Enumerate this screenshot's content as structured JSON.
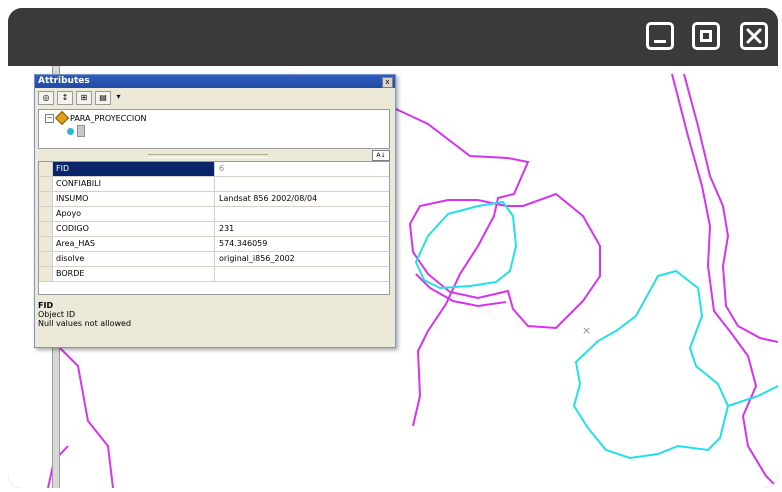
{
  "window": {
    "controls": [
      "minimize-icon",
      "maximize-icon",
      "close-icon"
    ],
    "colors": {
      "titlebar": "#3a3a3a",
      "map_background": "#ffffff"
    }
  },
  "attributes": {
    "title": "Attributes",
    "close_glyph": "x",
    "toolbar_icons": [
      "layers-icon",
      "sort-icon",
      "identify-icon",
      "options-icon",
      "dropdown-arrow-icon"
    ],
    "layer_name": "PARA_PROYECCION",
    "fields": [
      {
        "name": "FID",
        "value": "6"
      },
      {
        "name": "CONFIABILI",
        "value": ""
      },
      {
        "name": "INSUMO",
        "value": "Landsat 856 2002/08/04"
      },
      {
        "name": "Apoyo",
        "value": ""
      },
      {
        "name": "CODIGO",
        "value": "231"
      },
      {
        "name": "Area_HAS",
        "value": "574.346059"
      },
      {
        "name": "disolve",
        "value": "original_i856_2002"
      },
      {
        "name": "BORDE",
        "value": ""
      }
    ],
    "selected_field": "FID",
    "description": {
      "title": "FID",
      "line1": "Object ID",
      "line2": "Null values not allowed"
    }
  },
  "map": {
    "colors": {
      "polygon_outline": "#d633f0",
      "selected_outline": "#22e0e8"
    },
    "marker_glyph": "×"
  }
}
